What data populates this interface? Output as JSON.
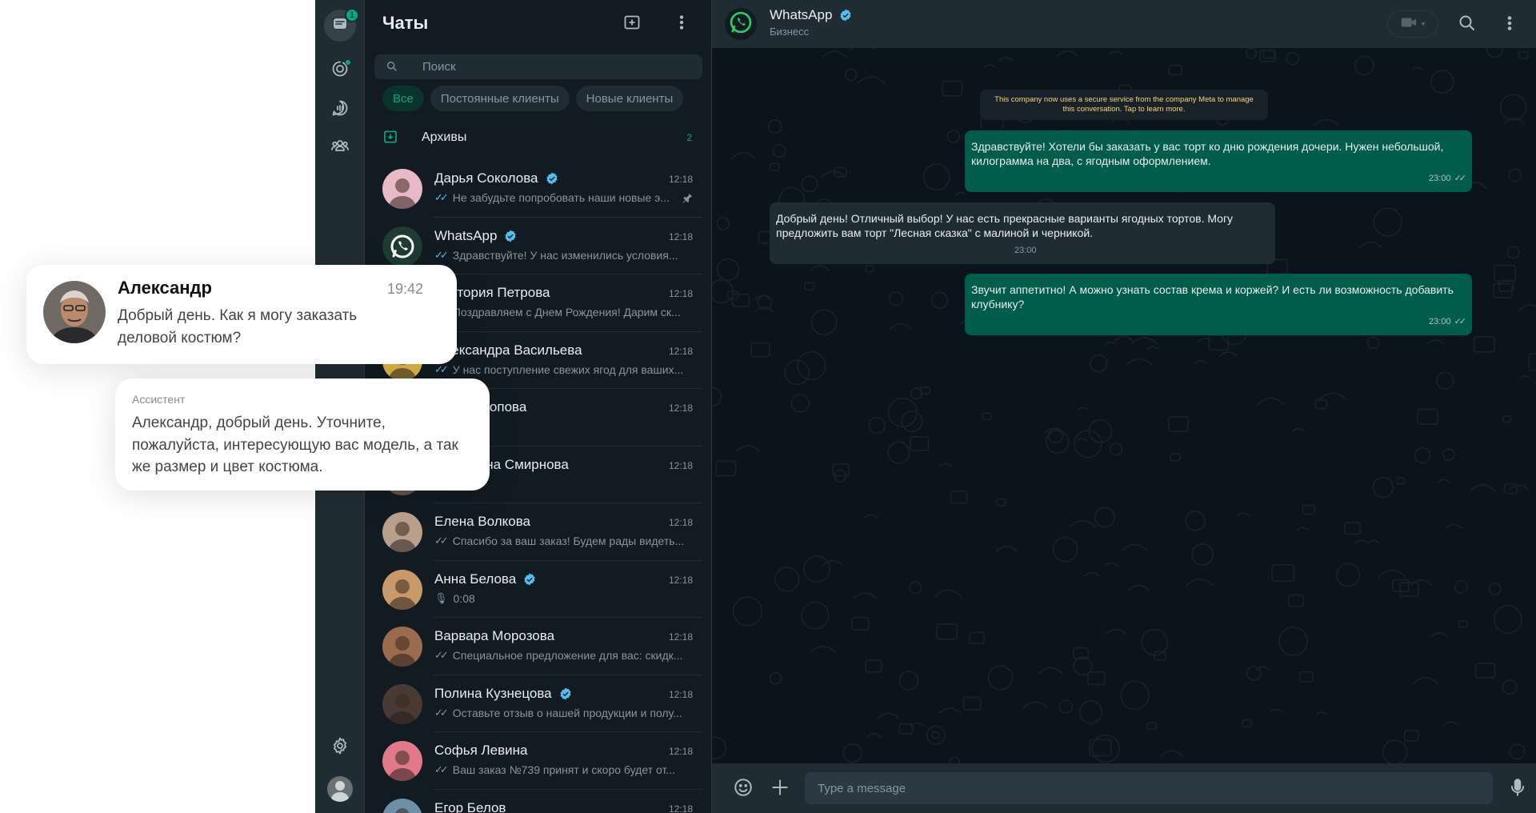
{
  "rail": {
    "chats_badge": "1"
  },
  "chatlist": {
    "title": "Чаты",
    "search_placeholder": "Поиск",
    "filters": [
      "Все",
      "Постоянные клиенты",
      "Новые клиенты"
    ],
    "archive": {
      "label": "Архивы",
      "count": "2"
    },
    "chats": [
      {
        "name": "Дарья Соколова",
        "verified": true,
        "time": "12:18",
        "preview": "Не забудьте попробовать наши новые э...",
        "ticks": "blue",
        "pinned": true,
        "avatar_color": "#e8b9c6"
      },
      {
        "name": "WhatsApp",
        "verified": true,
        "time": "12:18",
        "preview": "Здравствуйте! У нас изменились условия...",
        "ticks": "blue",
        "avatar_color": "#1f2c33"
      },
      {
        "name": "Виктория Петрова",
        "verified": false,
        "time": "12:18",
        "preview": "Поздравляем с Днем Рождения! Дарим ск...",
        "ticks": "blue",
        "avatar_color": "#8d6e63"
      },
      {
        "name": "Александра Васильева",
        "verified": false,
        "time": "12:18",
        "preview": "У нас поступление свежих ягод для ваших...",
        "ticks": "blue",
        "avatar_color": "#e0b84a"
      },
      {
        "name": "Мария Попова",
        "verified": false,
        "time": "12:18",
        "preview": "",
        "ticks": "",
        "avatar_color": "#7a8f9a"
      },
      {
        "name": "Екатерина Смирнова",
        "verified": false,
        "time": "12:18",
        "preview": "",
        "ticks": "",
        "avatar_color": "#a89080"
      },
      {
        "name": "Елена Волкова",
        "verified": false,
        "time": "12:18",
        "preview": "Спасибо за ваш заказ! Будем рады видеть...",
        "ticks": "grey",
        "avatar_color": "#b9a08c"
      },
      {
        "name": "Анна Белова",
        "verified": true,
        "time": "12:18",
        "preview": "0:08",
        "ticks": "",
        "mic": true,
        "avatar_color": "#c89a6a"
      },
      {
        "name": "Варвара Морозова",
        "verified": false,
        "time": "12:18",
        "preview": "Специальное предложение для вас: скидк...",
        "ticks": "grey",
        "avatar_color": "#9b6b4e"
      },
      {
        "name": "Полина Кузнецова",
        "verified": true,
        "time": "12:18",
        "preview": "Оставьте отзыв о нашей продукции и полу...",
        "ticks": "grey",
        "avatar_color": "#4a3a34"
      },
      {
        "name": "Софья Левина",
        "verified": false,
        "time": "12:18",
        "preview": "Ваш заказ №739 принят и скоро будет от...",
        "ticks": "grey",
        "avatar_color": "#e07a8a"
      },
      {
        "name": "Егор Белов",
        "verified": false,
        "time": "12:18",
        "preview": "",
        "ticks": "",
        "avatar_color": "#6d8fa8"
      }
    ]
  },
  "chat": {
    "name": "WhatsApp",
    "subtitle": "Бизнесс",
    "notice": "This company now uses a secure service from the company Meta to manage this conversation. Tap to learn more.",
    "messages": [
      {
        "dir": "out",
        "text": "Здравствуйте! Хотели бы заказать у вас торт ко дню рождения дочери. Нужен небольшой, килограмма на два, с ягодным оформлением.",
        "time": "23:00"
      },
      {
        "dir": "in",
        "text": "Добрый день! Отличный выбор! У нас есть прекрасные варианты ягодных тортов. Могу предложить вам торт \"Лесная сказка\" с малиной и черникой.",
        "time": "23:00"
      },
      {
        "dir": "out",
        "text": "Звучит аппетитно! А можно узнать состав крема и коржей? И есть ли возможность добавить клубнику?",
        "time": "23:00"
      }
    ],
    "input_placeholder": "Type a message"
  },
  "overlay": {
    "customer": {
      "name": "Александр",
      "time": "19:42",
      "text": "Добрый день. Как я могу заказать деловой костюм?"
    },
    "assistant": {
      "label": "Ассистент",
      "text": "Александр, добрый день. Уточните, пожалуйста, интересующую вас модель, а так же размер и цвет костюма."
    }
  },
  "colors": {
    "accent": "#00a884",
    "outgoing_bubble": "#005c4b",
    "incoming_bubble": "#202c33",
    "verified": "#53bdeb"
  }
}
